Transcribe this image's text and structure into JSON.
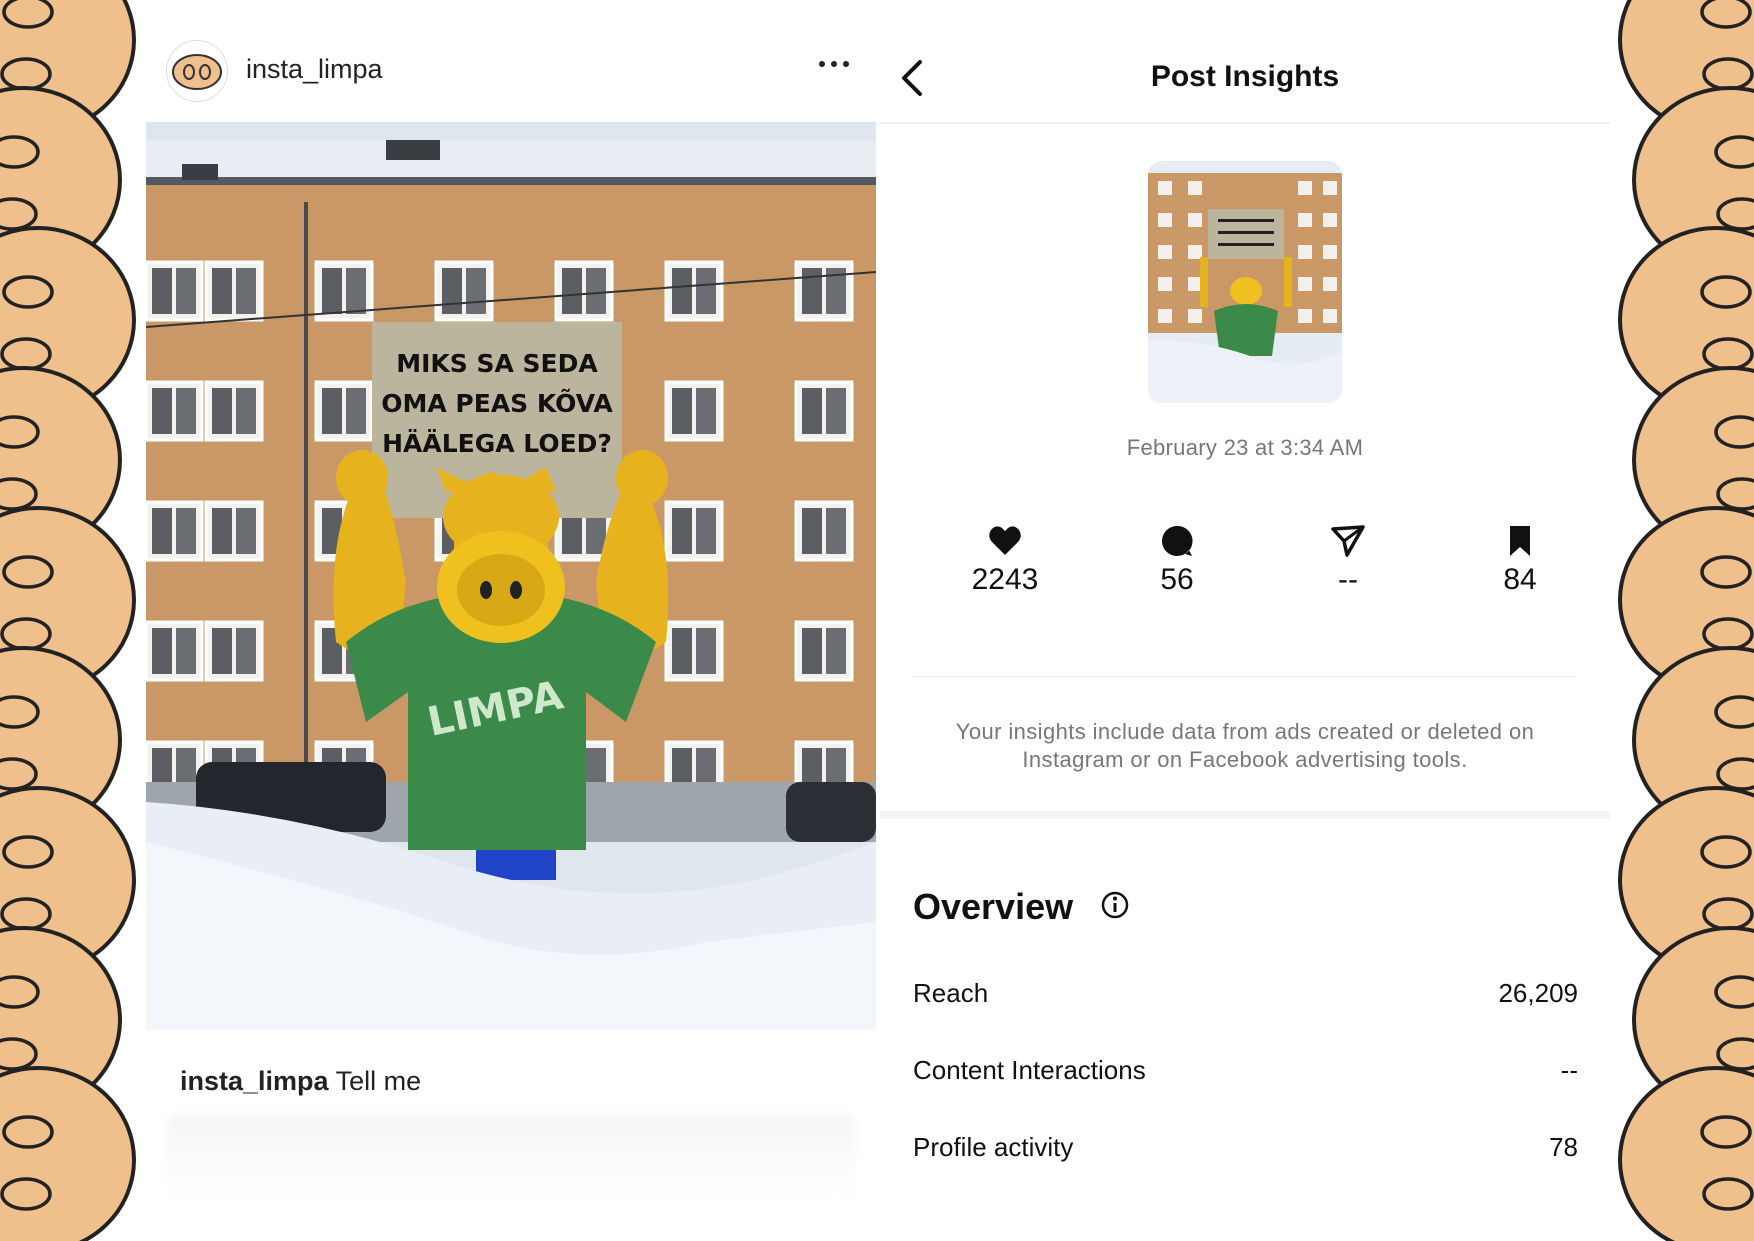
{
  "post": {
    "username": "insta_limpa",
    "caption_user": "insta_limpa",
    "caption_text": "Tell me",
    "sign_lines": [
      "MIKS SA SEDA",
      "OMA PEAS KÕVA",
      "HÄÄLEGA LOED?"
    ],
    "shirt_text": "LIMPA"
  },
  "insights": {
    "title": "Post Insights",
    "date": "February 23 at 3:34 AM",
    "metrics": [
      {
        "icon": "heart-icon",
        "value": "2243"
      },
      {
        "icon": "comment-icon",
        "value": "56"
      },
      {
        "icon": "share-icon",
        "value": "--"
      },
      {
        "icon": "bookmark-icon",
        "value": "84"
      }
    ],
    "note": "Your insights include data from ads created or deleted on Instagram or on Facebook advertising tools.",
    "overview": {
      "title": "Overview",
      "rows": [
        {
          "label": "Reach",
          "value": "26,209"
        },
        {
          "label": "Content Interactions",
          "value": "--"
        },
        {
          "label": "Profile activity",
          "value": "78"
        }
      ]
    }
  },
  "colors": {
    "border_fill": "#f0c08c",
    "building": "#c99866",
    "snow": "#e9eef6",
    "shirt": "#3b8a4a",
    "mascot": "#e6b31e"
  }
}
